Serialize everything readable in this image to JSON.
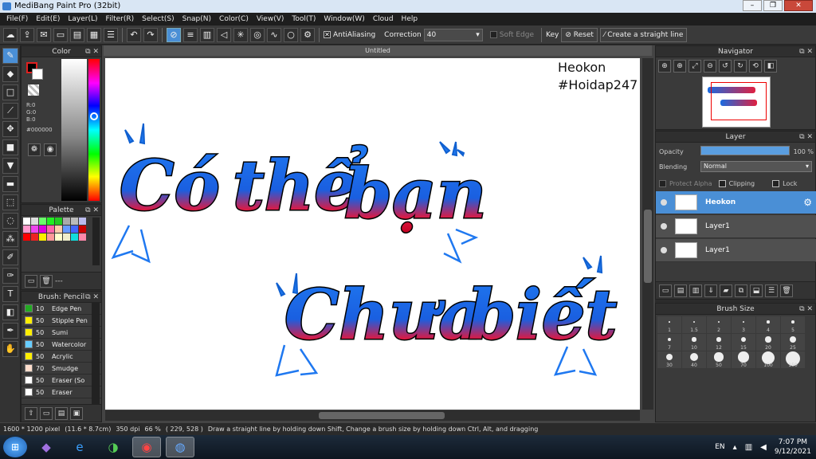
{
  "titlebar": {
    "title": "MediBang Paint Pro (32bit)"
  },
  "menu": [
    "File(F)",
    "Edit(E)",
    "Layer(L)",
    "Filter(R)",
    "Select(S)",
    "Snap(N)",
    "Color(C)",
    "View(V)",
    "Tool(T)",
    "Window(W)",
    "Cloud",
    "Help"
  ],
  "toolbar": {
    "antialiasing": "AntiAliasing",
    "correction_label": "Correction",
    "correction_value": "40",
    "soft_edge": "Soft Edge",
    "key_label": "Key",
    "reset_label": "Reset",
    "straight_line_label": "Create a straight line"
  },
  "color_panel": {
    "title": "Color",
    "r": "R:0",
    "g": "G:0",
    "b": "B:0",
    "hex": "#000000"
  },
  "palette_panel": {
    "title": "Palette",
    "footer_text": "---",
    "swatches": [
      "#ffffff",
      "#dddddd",
      "#6aff6a",
      "#22ee22",
      "#22cc22",
      "#aaaaaa",
      "#bbbbbb",
      "#bbbbee",
      "#ff99cc",
      "#ee44ee",
      "#dd00dd",
      "#ff66aa",
      "#ffccaa",
      "#6699ff",
      "#4466ff",
      "#cc0000",
      "#ff0000",
      "#ee2222",
      "#ffee00",
      "#ff9999",
      "#ffffcc",
      "#eeeecc",
      "#11dddd",
      "#ff88aa"
    ]
  },
  "brush_panel": {
    "title": "Brush: Pencil",
    "items": [
      {
        "size": "10",
        "name": "Edge Pen",
        "color": "#22aa22"
      },
      {
        "size": "50",
        "name": "Stipple Pen",
        "color": "#ffee00"
      },
      {
        "size": "50",
        "name": "Sumi",
        "color": "#ffee00"
      },
      {
        "size": "50",
        "name": "Watercolor",
        "color": "#66ccff"
      },
      {
        "size": "50",
        "name": "Acrylic",
        "color": "#ffee00"
      },
      {
        "size": "70",
        "name": "Smudge",
        "color": "#ffddcc"
      },
      {
        "size": "50",
        "name": "Eraser (So",
        "color": "#ffffff"
      },
      {
        "size": "50",
        "name": "Eraser",
        "color": "#ffffff"
      }
    ]
  },
  "document": {
    "tab_title": "Untitled",
    "watermark_line1": "Heokon",
    "watermark_line2": "#Hoidap247"
  },
  "navigator": {
    "title": "Navigator"
  },
  "layer_panel": {
    "title": "Layer",
    "opacity_label": "Opacity",
    "opacity_value": "100 %",
    "blending_label": "Blending",
    "blending_value": "Normal",
    "protect_alpha": "Protect Alpha",
    "clipping": "Clipping",
    "lock": "Lock",
    "layers": [
      {
        "name": "Heokon",
        "selected": true
      },
      {
        "name": "Layer1",
        "selected": false
      },
      {
        "name": "Layer1",
        "selected": false
      }
    ]
  },
  "brush_size_panel": {
    "title": "Brush Size",
    "sizes": [
      "1",
      "1.5",
      "2",
      "3",
      "4",
      "5",
      "7",
      "10",
      "12",
      "15",
      "20",
      "25",
      "30",
      "40",
      "50",
      "70",
      "100",
      "150"
    ]
  },
  "statusbar": {
    "size": "1600 * 1200 pixel",
    "cm": "(11.6 * 8.7cm)",
    "dpi": "350 dpi",
    "zoom": "66 %",
    "coords": "( 229, 528 )",
    "hint": "Draw a straight line by holding down Shift, Change a brush size by holding down Ctrl, Alt, and dragging"
  },
  "taskbar": {
    "lang": "EN",
    "time": "7:07 PM",
    "date": "9/12/2021"
  }
}
